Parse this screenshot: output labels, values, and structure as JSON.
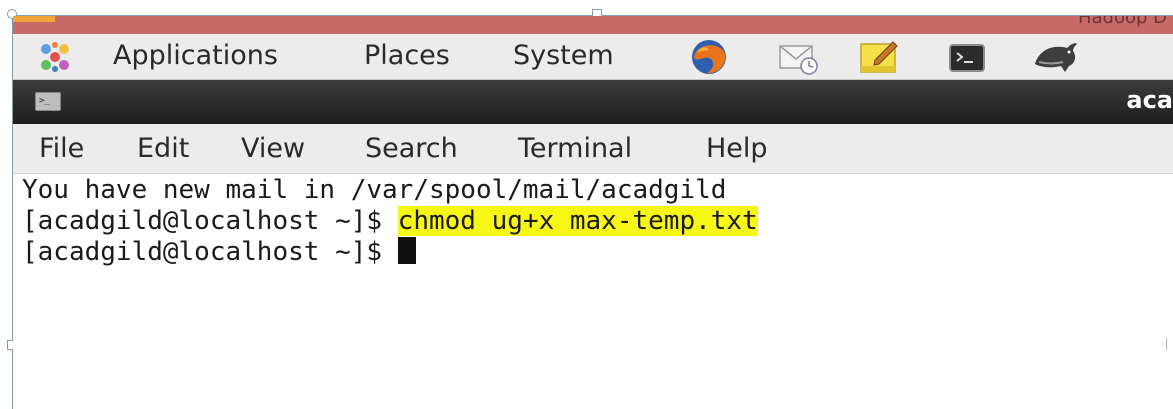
{
  "window_title_partial": "Hadoop D",
  "panel": {
    "menus": [
      "Applications",
      "Places",
      "System"
    ],
    "launchers": [
      "firefox-icon",
      "mail-icon",
      "notes-icon",
      "terminal-icon",
      "dolphin-icon"
    ]
  },
  "titlebar": {
    "title_partial": "aca"
  },
  "menubar": {
    "items": [
      "File",
      "Edit",
      "View",
      "Search",
      "Terminal",
      "Help"
    ]
  },
  "terminal": {
    "line1": "You have new mail in /var/spool/mail/acadgild",
    "prompt1": "[acadgild@localhost ~]$ ",
    "command1": "chmod ug+x max-temp.txt",
    "prompt2": "[acadgild@localhost ~]$ "
  },
  "colors": {
    "highlight": "#f7f716",
    "titlebar": "#2a2a2a",
    "top_strip": "#c96a6a"
  }
}
